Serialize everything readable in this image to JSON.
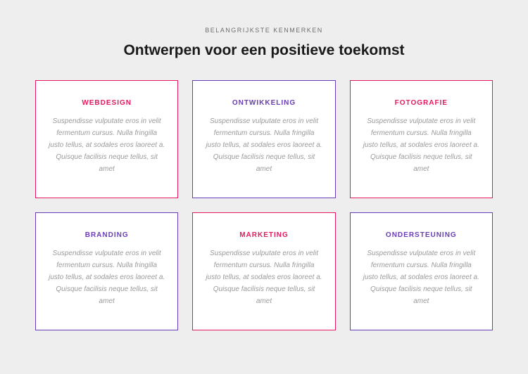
{
  "eyebrow": "BELANGRIJKSTE KENMERKEN",
  "headline": "Ontwerpen voor een positieve toekomst",
  "colors": {
    "pink": "#e6185e",
    "purple": "#6a3db7"
  },
  "cards": [
    {
      "title": "WEBDESIGN",
      "desc": "Suspendisse vulputate eros in velit fermentum cursus. Nulla fringilla justo tellus, at sodales eros laoreet a. Quisque facilisis neque tellus, sit amet"
    },
    {
      "title": "ONTWIKKELING",
      "desc": "Suspendisse vulputate eros in velit fermentum cursus. Nulla fringilla justo tellus, at sodales eros laoreet a. Quisque facilisis neque tellus, sit amet"
    },
    {
      "title": "FOTOGRAFIE",
      "desc": "Suspendisse vulputate eros in velit fermentum cursus. Nulla fringilla justo tellus, at sodales eros laoreet a. Quisque facilisis neque tellus, sit amet"
    },
    {
      "title": "BRANDING",
      "desc": "Suspendisse vulputate eros in velit fermentum cursus. Nulla fringilla justo tellus, at sodales eros laoreet a. Quisque facilisis neque tellus, sit amet"
    },
    {
      "title": "MARKETING",
      "desc": "Suspendisse vulputate eros in velit fermentum cursus. Nulla fringilla justo tellus, at sodales eros laoreet a. Quisque facilisis neque tellus, sit amet"
    },
    {
      "title": "ONDERSTEUNING",
      "desc": "Suspendisse vulputate eros in velit fermentum cursus. Nulla fringilla justo tellus, at sodales eros laoreet a. Quisque facilisis neque tellus, sit amet"
    }
  ]
}
